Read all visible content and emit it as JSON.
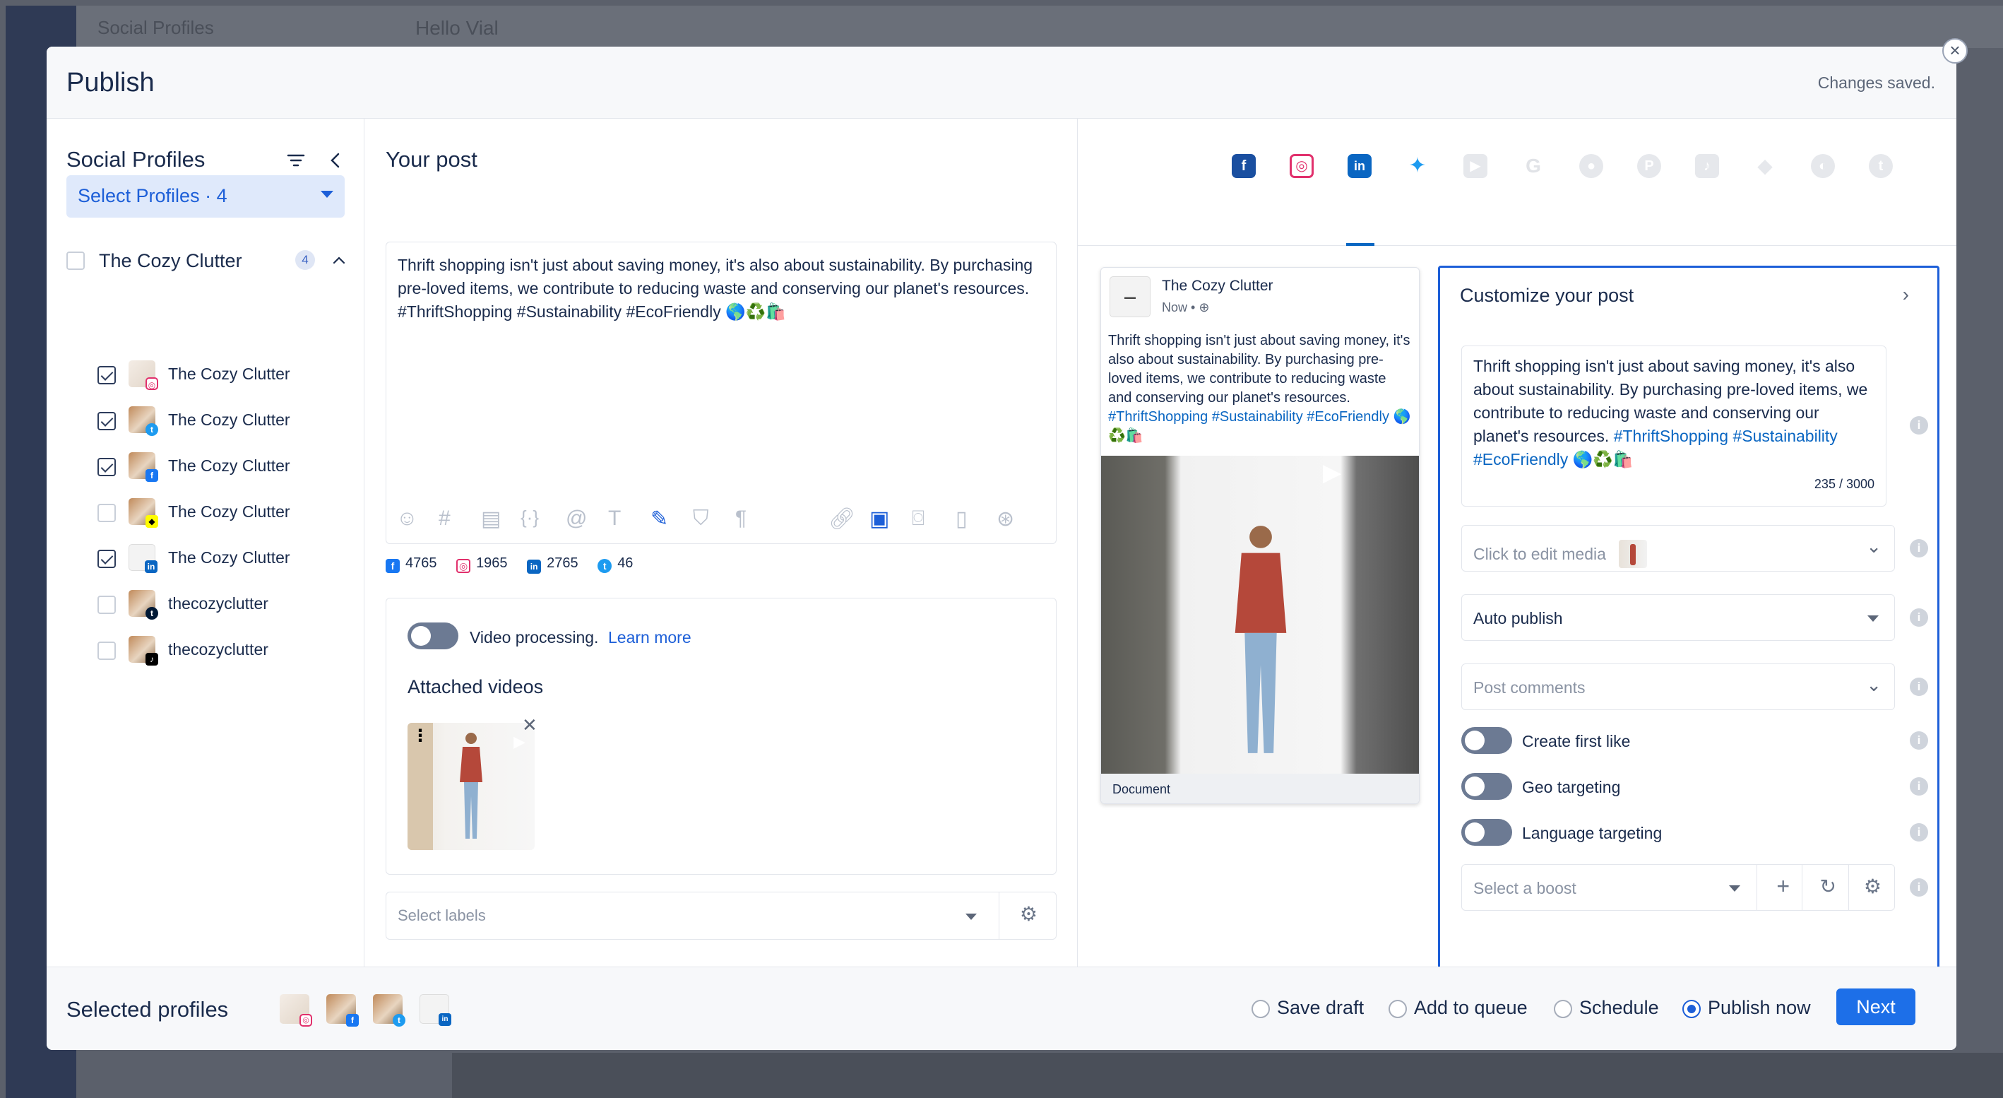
{
  "background": {
    "title": "Social Profiles",
    "greeting": "Hello Vial"
  },
  "modal": {
    "title": "Publish",
    "status": "Changes saved."
  },
  "left": {
    "heading": "Social Profiles",
    "select_profiles": "Select Profiles · 4",
    "group_name": "The Cozy Clutter",
    "group_count": "4",
    "profiles": [
      {
        "name": "The Cozy Clutter",
        "network": "instagram",
        "checked": true
      },
      {
        "name": "The Cozy Clutter",
        "network": "twitter",
        "checked": true
      },
      {
        "name": "The Cozy Clutter",
        "network": "facebook",
        "checked": true
      },
      {
        "name": "The Cozy Clutter",
        "network": "snapchat",
        "checked": false
      },
      {
        "name": "The Cozy Clutter",
        "network": "linkedin",
        "checked": true
      },
      {
        "name": "thecozyclutter",
        "network": "tumblr",
        "checked": false
      },
      {
        "name": "thecozyclutter",
        "network": "tiktok",
        "checked": false
      }
    ]
  },
  "middle": {
    "heading": "Your post",
    "post_text": "Thrift shopping isn't just about saving money, it's also about sustainability. By purchasing pre-loved items, we contribute to reducing waste and conserving our planet's resources. #ThriftShopping #Sustainability #EcoFriendly 🌎♻️🛍️",
    "counts": {
      "facebook": "4765",
      "instagram": "1965",
      "linkedin": "2765",
      "twitter": "46"
    },
    "video_processing": "Video processing.",
    "learn_more": "Learn more",
    "attached_videos": "Attached videos",
    "labels_placeholder": "Select labels"
  },
  "preview": {
    "name": "The Cozy Clutter",
    "time": "Now •",
    "text": "Thrift shopping isn't just about saving money, it's also about sustainability. By purchasing pre-loved items, we contribute to reducing waste and conserving our planet's resources.",
    "hashtags": "#ThriftShopping #Sustainability #EcoFriendly",
    "emoji": "🌎♻️🛍️",
    "doc_label": "Document"
  },
  "customize": {
    "title": "Customize your post",
    "text": "Thrift shopping isn't just about saving money, it's also about sustainability. By purchasing pre-loved items, we contribute to reducing waste and conserving our planet's resources.",
    "hashtags": "#ThriftShopping #Sustainability #EcoFriendly",
    "emoji": "🌎♻️🛍️",
    "char_count": "235 / 3000",
    "edit_media": "Click to edit media",
    "auto_publish": "Auto publish",
    "post_comments": "Post comments",
    "first_like": "Create first like",
    "geo": "Geo targeting",
    "language": "Language targeting",
    "boost": "Select a boost"
  },
  "footer": {
    "title": "Selected profiles",
    "save_draft": "Save draft",
    "add_queue": "Add to queue",
    "schedule": "Schedule",
    "publish_now": "Publish now",
    "next": "Next"
  },
  "colors": {
    "accent": "#1d6fe8",
    "linkedin": "#0a66c2",
    "facebook": "#1877f2",
    "twitter": "#1d9bf0",
    "instagram": "#e1306c"
  }
}
